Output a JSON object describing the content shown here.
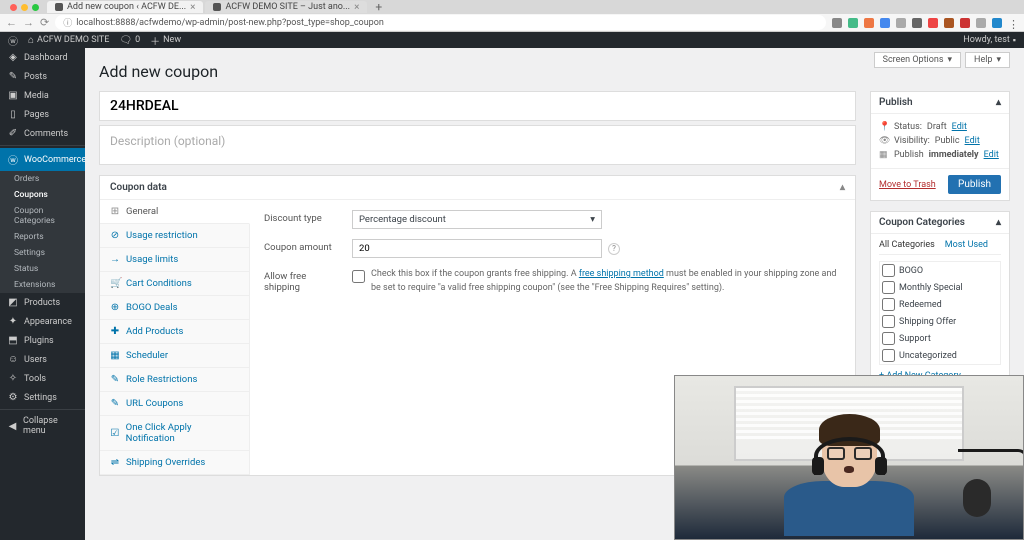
{
  "browser": {
    "tabs": [
      {
        "title": "Add new coupon ‹ ACFW DE..."
      },
      {
        "title": "ACFW DEMO SITE – Just ano..."
      }
    ],
    "url": "localhost:8888/acfwdemo/wp-admin/post-new.php?post_type=shop_coupon"
  },
  "wpbar": {
    "site": "ACFW DEMO SITE",
    "comments": "0",
    "new": "New",
    "howdy": "Howdy, test"
  },
  "top_actions": {
    "screen_options": "Screen Options",
    "help": "Help"
  },
  "sidebar": {
    "items": [
      {
        "icon": "◈",
        "label": "Dashboard"
      },
      {
        "icon": "✎",
        "label": "Posts"
      },
      {
        "icon": "▣",
        "label": "Media"
      },
      {
        "icon": "▯",
        "label": "Pages"
      },
      {
        "icon": "✐",
        "label": "Comments"
      }
    ],
    "woo": {
      "icon": "ⓦ",
      "label": "WooCommerce"
    },
    "woo_sub": [
      "Orders",
      "Coupons",
      "Coupon Categories",
      "Reports",
      "Settings",
      "Status",
      "Extensions"
    ],
    "items2": [
      {
        "icon": "◩",
        "label": "Products"
      },
      {
        "icon": "✦",
        "label": "Appearance"
      },
      {
        "icon": "⬒",
        "label": "Plugins"
      },
      {
        "icon": "☺",
        "label": "Users"
      },
      {
        "icon": "✧",
        "label": "Tools"
      },
      {
        "icon": "⚙",
        "label": "Settings"
      }
    ],
    "collapse": "Collapse menu"
  },
  "page": {
    "title": "Add new coupon",
    "coupon_title": "24HRDEAL",
    "description_placeholder": "Description (optional)"
  },
  "metabox_title": "Coupon data",
  "vtabs": [
    {
      "icon": "⊞",
      "label": "General"
    },
    {
      "icon": "⊘",
      "label": "Usage restriction"
    },
    {
      "icon": "→",
      "label": "Usage limits"
    },
    {
      "icon": "🛒",
      "label": "Cart Conditions"
    },
    {
      "icon": "⊕",
      "label": "BOGO Deals"
    },
    {
      "icon": "✚",
      "label": "Add Products"
    },
    {
      "icon": "▦",
      "label": "Scheduler"
    },
    {
      "icon": "✎",
      "label": "Role Restrictions"
    },
    {
      "icon": "✎",
      "label": "URL Coupons"
    },
    {
      "icon": "☑",
      "label": "One Click Apply Notification"
    },
    {
      "icon": "⇌",
      "label": "Shipping Overrides"
    }
  ],
  "panel": {
    "discount_type_label": "Discount type",
    "discount_type_value": "Percentage discount",
    "coupon_amount_label": "Coupon amount",
    "coupon_amount_value": "20",
    "allow_free_shipping_label": "Allow free shipping",
    "free_ship_text_pre": "Check this box if the coupon grants free shipping. A ",
    "free_ship_link": "free shipping method",
    "free_ship_text_post": " must be enabled in your shipping zone and be set to require \"a valid free shipping coupon\" (see the \"Free Shipping Requires\" setting)."
  },
  "publish_box": {
    "title": "Publish",
    "status_label": "Status:",
    "status_value": "Draft",
    "visibility_label": "Visibility:",
    "visibility_value": "Public",
    "publish_label": "Publish",
    "publish_value": "immediately",
    "edit": "Edit",
    "trash": "Move to Trash",
    "button": "Publish"
  },
  "categories_box": {
    "title": "Coupon Categories",
    "all_tab": "All Categories",
    "most_tab": "Most Used",
    "items": [
      "BOGO",
      "Monthly Special",
      "Redeemed",
      "Shipping Offer",
      "Support",
      "Uncategorized"
    ],
    "add_new": "+ Add New Category"
  }
}
